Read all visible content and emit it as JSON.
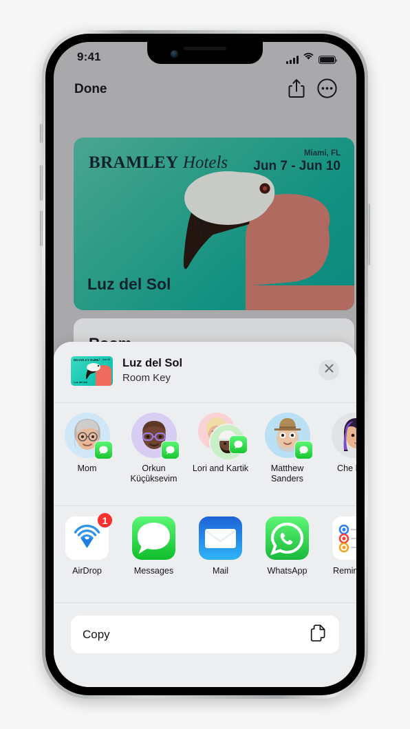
{
  "status_bar": {
    "time": "9:41",
    "signal_icon": "cellular-bars-icon",
    "wifi_icon": "wifi-icon",
    "battery_icon": "battery-full-icon"
  },
  "nav_bar": {
    "done_label": "Done",
    "share_icon": "share-icon",
    "more_icon": "more-circle-icon"
  },
  "pass": {
    "brand_bold": "BRAMLEY",
    "brand_italic": "Hotels",
    "location": "Miami, FL",
    "dates": "Jun 7 - Jun 10",
    "title": "Luz del Sol",
    "bg_color": "#12917f",
    "text_color": "#10232c",
    "art": "flamingo-illustration"
  },
  "room_card": {
    "label": "Room"
  },
  "share_sheet": {
    "thumbnail": {
      "brand": "BRAMLEY Hotels",
      "dates": "Jun 7 - Jun 10",
      "title": "Luz del Sol",
      "art": "flamingo-illustration"
    },
    "title": "Luz del Sol",
    "subtitle": "Room Key",
    "close_icon": "close-icon",
    "contacts": [
      {
        "name": "Mom",
        "badge_app": "messages-icon",
        "avatar": "memoji-gray-hair-glasses",
        "bg": "#cfe7f7"
      },
      {
        "name": "Orkun Küçüksevim",
        "badge_app": "messages-icon",
        "avatar": "memoji-bald-purple-glasses",
        "bg": "#d8cdf2"
      },
      {
        "name": "Lori and Kartik",
        "badge_app": "messages-icon",
        "avatar": "memoji-group-two",
        "bg": "#f9d2d6"
      },
      {
        "name": "Matthew Sanders",
        "badge_app": "messages-icon",
        "avatar": "memoji-hat-beard",
        "bg": "#b9e0f5"
      },
      {
        "name": "Che Boe",
        "badge_app": "messages-icon",
        "avatar": "memoji-purple-hair",
        "bg": "#e2e3e5"
      }
    ],
    "apps": [
      {
        "label": "AirDrop",
        "icon": "airdrop-icon",
        "badge": "1"
      },
      {
        "label": "Messages",
        "icon": "messages-icon",
        "badge": ""
      },
      {
        "label": "Mail",
        "icon": "mail-icon",
        "badge": ""
      },
      {
        "label": "WhatsApp",
        "icon": "whatsapp-icon",
        "badge": ""
      },
      {
        "label": "Reminders",
        "icon": "reminders-icon",
        "badge": ""
      }
    ],
    "actions": [
      {
        "label": "Copy",
        "icon": "copy-icon"
      }
    ]
  }
}
